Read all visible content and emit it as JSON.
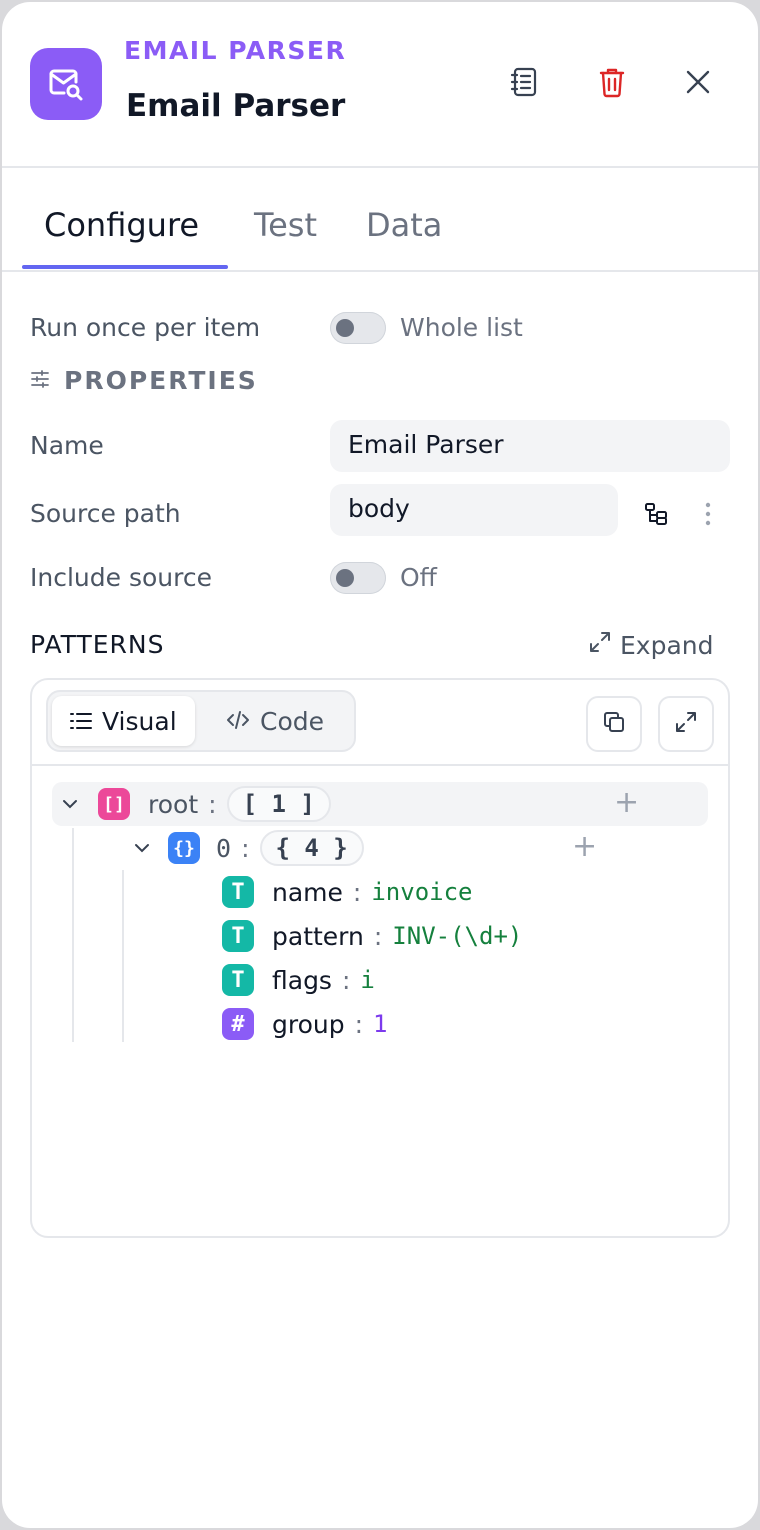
{
  "header": {
    "kicker": "EMAIL PARSER",
    "title": "Email Parser",
    "app_icon": "mail-search-icon",
    "accent": "#8b5cf6"
  },
  "tabs": [
    {
      "label": "Configure",
      "active": true
    },
    {
      "label": "Test",
      "active": false
    },
    {
      "label": "Data",
      "active": false
    }
  ],
  "form": {
    "run_once_label": "Run once per item",
    "run_once_toggle_text": "Whole list",
    "properties_heading": "PROPERTIES",
    "name_label": "Name",
    "name_value": "Email Parser",
    "source_path_label": "Source path",
    "source_path_value": "body",
    "include_source_label": "Include source",
    "include_source_toggle_text": "Off"
  },
  "patterns": {
    "title": "PATTERNS",
    "expand_label": "Expand",
    "visual_label": "Visual",
    "code_label": "Code",
    "tree": {
      "root_key": "root",
      "root_count": "[ 1 ]",
      "item_key": "0",
      "item_count": "{ 4 }",
      "fields": [
        {
          "key": "name",
          "value": "invoice",
          "type": "string"
        },
        {
          "key": "pattern",
          "value": "INV-(\\d+)",
          "type": "string"
        },
        {
          "key": "flags",
          "value": "i",
          "type": "string"
        },
        {
          "key": "group",
          "value": "1",
          "type": "number"
        }
      ]
    }
  },
  "badges": {
    "array": "[]",
    "object": "{}",
    "string": "T",
    "number": "#"
  },
  "colors": {
    "tab_underline": "#6366f1",
    "delete": "#dc2626",
    "string_value": "#15803d",
    "number_value": "#7c3aed"
  }
}
